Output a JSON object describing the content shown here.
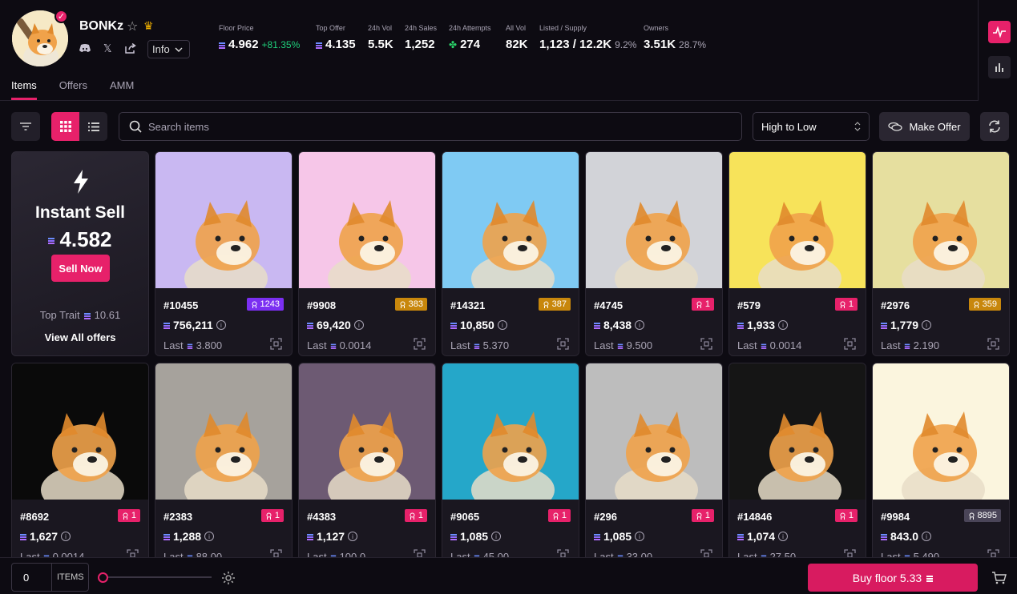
{
  "collection": {
    "name": "BONKz",
    "info_label": "Info"
  },
  "stats": [
    {
      "label": "Floor Price",
      "value": "4.962",
      "change": "+81.35%",
      "sol": true
    },
    {
      "label": "Top Offer",
      "value": "4.135",
      "sol": true
    },
    {
      "label": "24h Vol",
      "value": "5.5K"
    },
    {
      "label": "24h Sales",
      "value": "1,252"
    },
    {
      "label": "24h Attempts",
      "value": "274",
      "icon": "clover-icon"
    },
    {
      "label": "All Vol",
      "value": "82K"
    },
    {
      "label": "Listed / Supply",
      "value": "1,123 / 12.2K",
      "sub": "9.2%"
    },
    {
      "label": "Owners",
      "value": "3.51K",
      "sub": "28.7%"
    }
  ],
  "tabs": [
    "Items",
    "Offers",
    "AMM"
  ],
  "toolbar": {
    "search_placeholder": "Search items",
    "sort_label": "High to Low",
    "make_offer_label": "Make Offer"
  },
  "instant_sell": {
    "title": "Instant Sell",
    "price": "4.582",
    "button": "Sell Now",
    "top_trait_label": "Top Trait",
    "top_trait_value": "10.61",
    "view_all": "View All offers"
  },
  "items": [
    {
      "name": "#10455",
      "rank": "1243",
      "rank_color": "#7b2ff2",
      "price": "756,211",
      "last_label": "Last",
      "last": "3.800",
      "bg": "#c9b8f2"
    },
    {
      "name": "#9908",
      "rank": "383",
      "rank_color": "#c8870c",
      "price": "69,420",
      "last_label": "Last",
      "last": "0.0014",
      "bg": "#f6c6e8"
    },
    {
      "name": "#14321",
      "rank": "387",
      "rank_color": "#c8870c",
      "price": "10,850",
      "last_label": "Last",
      "last": "5.370",
      "bg": "#7fcaf3"
    },
    {
      "name": "#4745",
      "rank": "1",
      "rank_color": "#e7216a",
      "price": "8,438",
      "last_label": "Last",
      "last": "9.500",
      "bg": "#d2d3d8"
    },
    {
      "name": "#579",
      "rank": "1",
      "rank_color": "#e7216a",
      "price": "1,933",
      "last_label": "Last",
      "last": "0.0014",
      "bg": "#f7e35a"
    },
    {
      "name": "#2976",
      "rank": "359",
      "rank_color": "#c8870c",
      "price": "1,779",
      "last_label": "Last",
      "last": "2.190",
      "bg": "#e6df9f"
    },
    {
      "name": "#8692",
      "rank": "1",
      "rank_color": "#e7216a",
      "price": "1,627",
      "last_label": "Last",
      "last": "0.0014",
      "bg": "#0a0a0a"
    },
    {
      "name": "#2383",
      "rank": "1",
      "rank_color": "#e7216a",
      "price": "1,288",
      "last_label": "Last",
      "last": "88.00",
      "bg": "#a6a29c"
    },
    {
      "name": "#4383",
      "rank": "1",
      "rank_color": "#e7216a",
      "price": "1,127",
      "last_label": "Last",
      "last": "100.0",
      "bg": "#6d5a73"
    },
    {
      "name": "#9065",
      "rank": "1",
      "rank_color": "#e7216a",
      "price": "1,085",
      "last_label": "Last",
      "last": "45.00",
      "bg": "#25a7c9"
    },
    {
      "name": "#296",
      "rank": "1",
      "rank_color": "#e7216a",
      "price": "1,085",
      "last_label": "Last",
      "last": "33.00",
      "bg": "#bdbdbd"
    },
    {
      "name": "#14846",
      "rank": "1",
      "rank_color": "#e7216a",
      "price": "1,074",
      "last_label": "Last",
      "last": "27.50",
      "bg": "#151515"
    },
    {
      "name": "#9984",
      "rank": "8895",
      "rank_color": "#4a4558",
      "price": "843.0",
      "last_label": "Last",
      "last": "5.490",
      "bg": "#fbf5de"
    }
  ],
  "footer": {
    "quantity": "0",
    "quantity_unit": "ITEMS",
    "buy_label": "Buy floor 5.33"
  },
  "colors": {
    "accent": "#e7216a",
    "background": "#0d0b12",
    "card": "#1a1720"
  }
}
